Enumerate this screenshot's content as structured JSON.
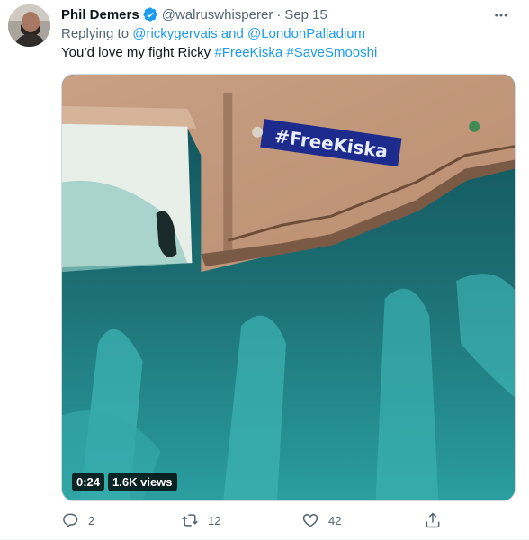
{
  "tweet": {
    "author": {
      "name": "Phil Demers",
      "handle": "@walruswhisperer",
      "verified": true
    },
    "separator": "·",
    "timestamp": "Sep 15",
    "replying_prefix": "Replying to",
    "replying_to": "@rickygervais and @LondonPalladium",
    "text_plain": "You’d love my fight Ricky",
    "hashtag_1": "#FreeKiska",
    "hashtag_2": "#SaveSmooshi",
    "media": {
      "banner_text": "#FreeKiska",
      "duration": "0:24",
      "views": "1.6K views"
    },
    "actions": {
      "reply_count": "2",
      "retweet_count": "12",
      "like_count": "42"
    }
  },
  "icons": {
    "verified": "verified-badge-icon",
    "more": "more-icon",
    "reply": "reply-icon",
    "retweet": "retweet-icon",
    "like": "heart-icon",
    "share": "share-icon"
  },
  "colors": {
    "link": "#1d9bf0",
    "secondary_text": "#536471",
    "primary_text": "#0f1419",
    "pool_water": "#1d7a7d",
    "deck": "#c59a7c"
  }
}
